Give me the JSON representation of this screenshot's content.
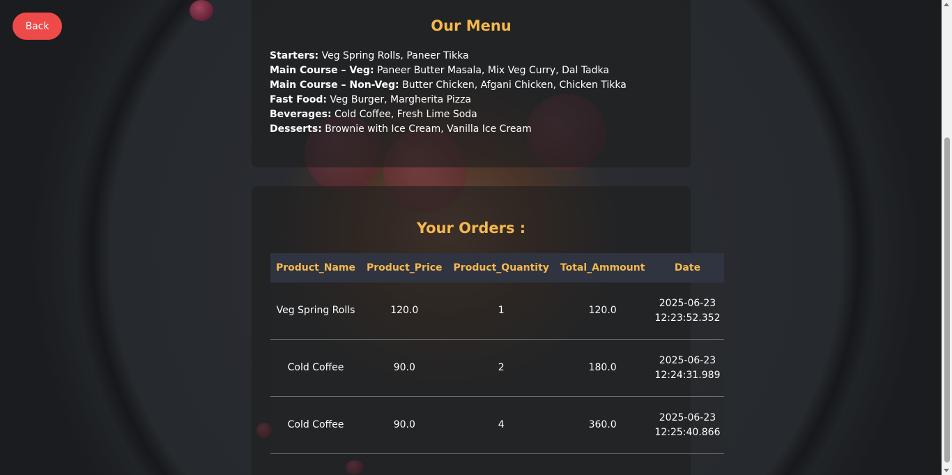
{
  "back_button": {
    "label": "Back"
  },
  "menu": {
    "title": "Our Menu",
    "lines": [
      {
        "category": "Starters:",
        "items": "Veg Spring Rolls, Paneer Tikka"
      },
      {
        "category": "Main Course – Veg:",
        "items": "Paneer Butter Masala, Mix Veg Curry, Dal Tadka"
      },
      {
        "category": "Main Course – Non-Veg:",
        "items": "Butter Chicken, Afgani Chicken, Chicken Tikka"
      },
      {
        "category": "Fast Food:",
        "items": "Veg Burger, Margherita Pizza"
      },
      {
        "category": "Beverages:",
        "items": "Cold Coffee, Fresh Lime Soda"
      },
      {
        "category": "Desserts:",
        "items": "Brownie with Ice Cream, Vanilla Ice Cream"
      }
    ]
  },
  "orders": {
    "title": "Your Orders :",
    "columns": [
      "Product_Name",
      "Product_Price",
      "Product_Quantity",
      "Total_Ammount",
      "Date"
    ],
    "rows": [
      {
        "name": "Veg Spring Rolls",
        "price": "120.0",
        "quantity": "1",
        "total": "120.0",
        "date": "2025-06-23 12:23:52.352"
      },
      {
        "name": "Cold Coffee",
        "price": "90.0",
        "quantity": "2",
        "total": "180.0",
        "date": "2025-06-23 12:24:31.989"
      },
      {
        "name": "Cold Coffee",
        "price": "90.0",
        "quantity": "4",
        "total": "360.0",
        "date": "2025-06-23 12:25:40.866"
      }
    ]
  },
  "colors": {
    "accent": "#f5b84e",
    "back_button": "#ef4a4a",
    "table_header_bg": "#2f3440"
  }
}
